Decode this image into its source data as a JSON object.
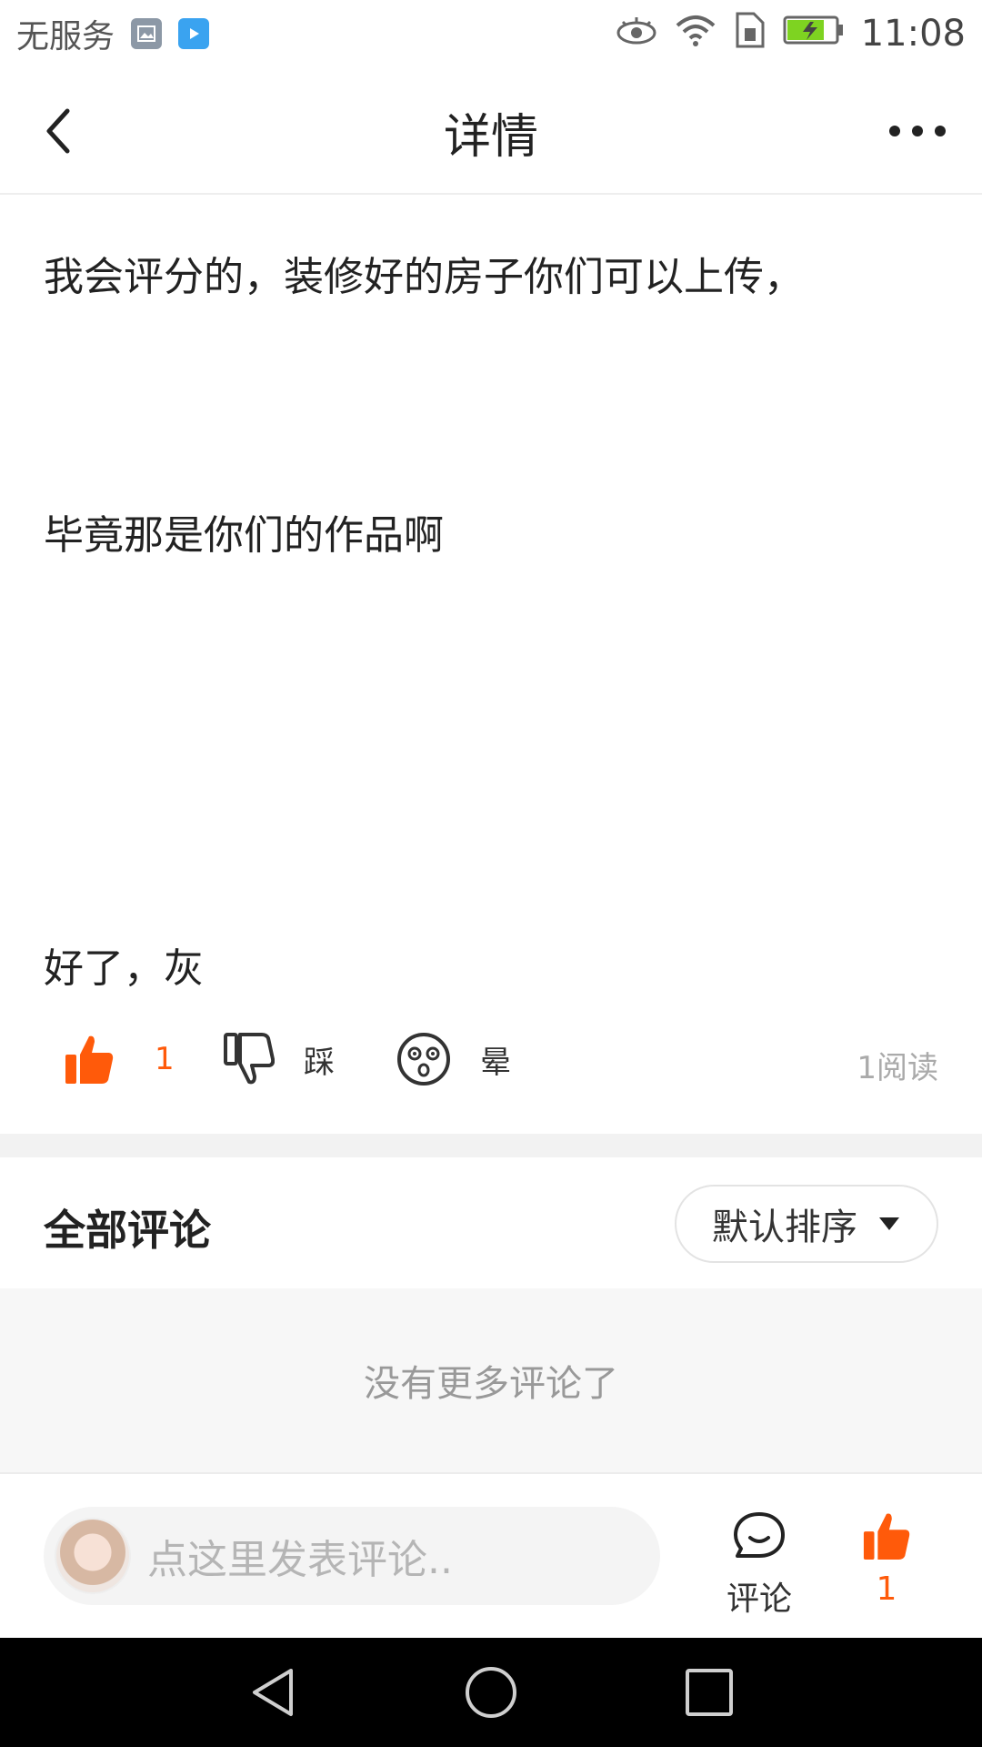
{
  "status_bar": {
    "carrier": "无服务",
    "time": "11:08",
    "icons": [
      "gallery-notification-icon",
      "video-notification-icon",
      "eye-icon",
      "wifi-icon",
      "sim-icon",
      "battery-charging-icon"
    ]
  },
  "header": {
    "title": "详情",
    "back_icon": "back-arrow-icon",
    "more_icon": "more-dots-icon"
  },
  "post": {
    "lines": [
      "我会评分的，装修好的房子你们可以上传，",
      "毕竟那是你们的作品啊",
      "好了，灰"
    ]
  },
  "reactions": {
    "like_count": "1",
    "dislike_label": "踩",
    "dizzy_label": "晕",
    "read_count": "1阅读",
    "accent_color": "#ff5a0a"
  },
  "comments": {
    "title": "全部评论",
    "sort_label": "默认排序",
    "empty_text": "没有更多评论了"
  },
  "bottom_bar": {
    "input_placeholder": "点这里发表评论..",
    "comment_label": "评论",
    "like_count": "1"
  },
  "nav_bar": {
    "icons": [
      "nav-back-icon",
      "nav-home-icon",
      "nav-recent-icon"
    ]
  }
}
